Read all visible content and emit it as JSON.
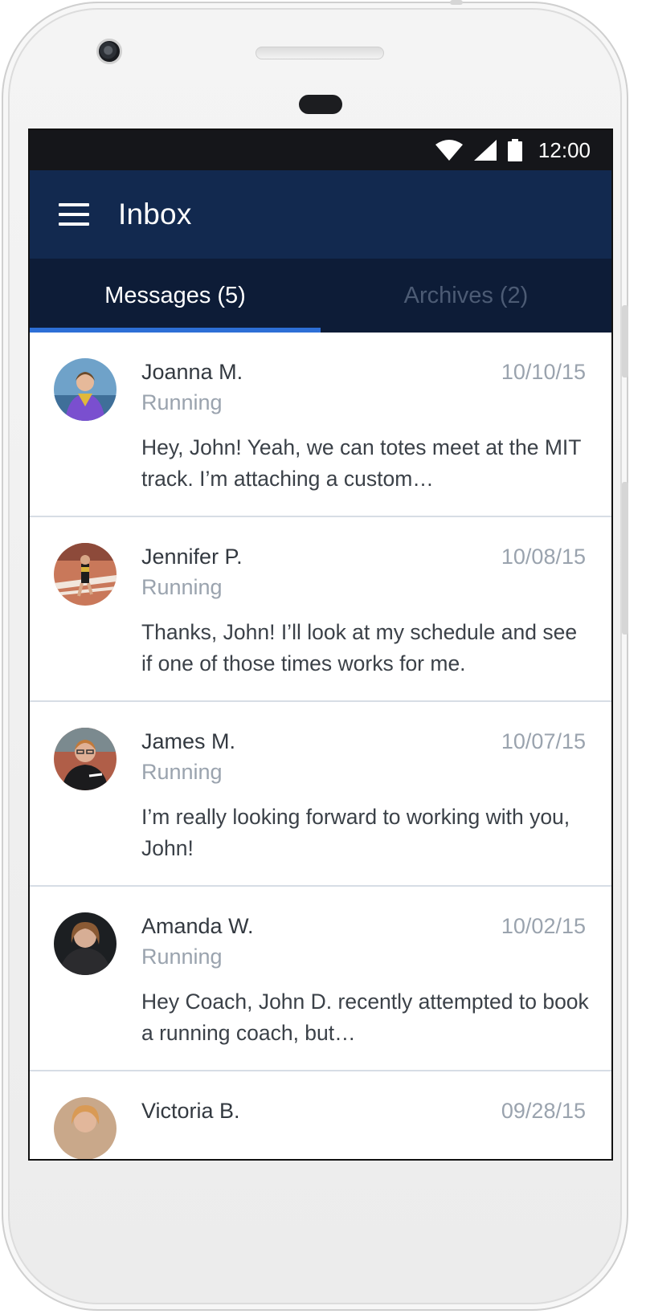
{
  "status_bar": {
    "time": "12:00",
    "icons": [
      "wifi-icon",
      "signal-icon",
      "battery-icon"
    ]
  },
  "app_bar": {
    "menu_icon": "hamburger-menu-icon",
    "title": "Inbox"
  },
  "tabs": [
    {
      "label": "Messages (5)",
      "active": true
    },
    {
      "label": "Archives (2)",
      "active": false
    }
  ],
  "messages": [
    {
      "name": "Joanna M.",
      "date": "10/10/15",
      "category": "Running",
      "preview": "Hey, John! Yeah, we can totes meet at the MIT track. I’m attaching a custom…"
    },
    {
      "name": "Jennifer P.",
      "date": "10/08/15",
      "category": "Running",
      "preview": "Thanks, John! I’ll look at my schedule and see if one of those times works for me."
    },
    {
      "name": "James M.",
      "date": "10/07/15",
      "category": "Running",
      "preview": "I’m really looking forward to working with you, John!"
    },
    {
      "name": "Amanda W.",
      "date": "10/02/15",
      "category": "Running",
      "preview": "Hey Coach, John D. recently attempted to book a running coach, but…"
    },
    {
      "name": "Victoria B.",
      "date": "09/28/15",
      "category": "",
      "preview": ""
    }
  ],
  "colors": {
    "app_bar": "#12294f",
    "tab_bar": "#0d1c37",
    "tab_indicator": "#2d6fd6",
    "status_bar": "#15161a"
  }
}
